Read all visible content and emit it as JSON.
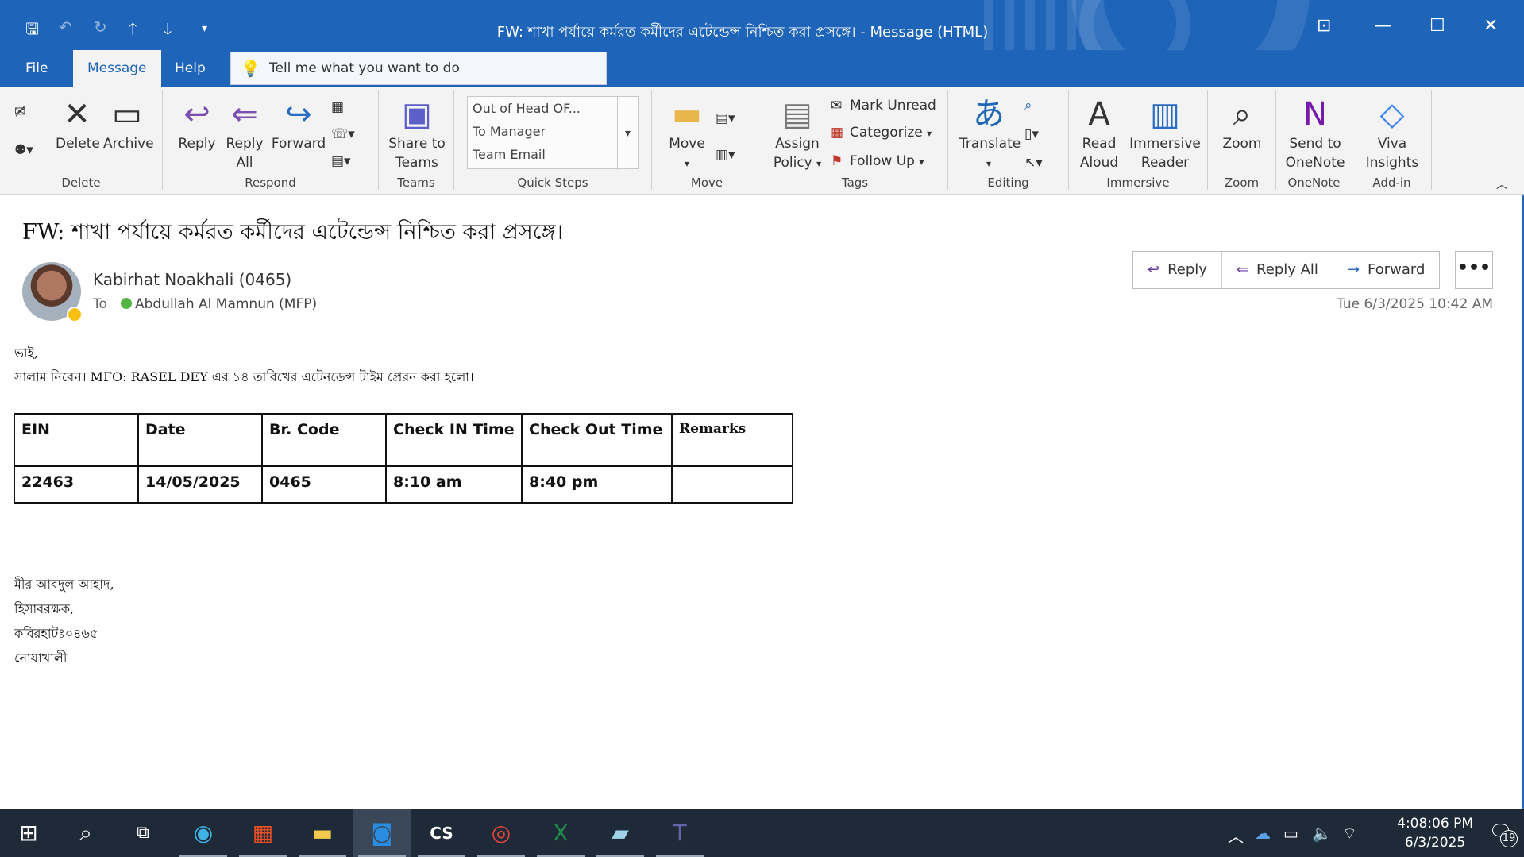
{
  "window": {
    "title": "FW: শাখা পর্যায়ে কর্মরত কর্মীদের এটেন্ডেন্স নিশ্চিত করা প্রসঙ্গে।  -  Message (HTML)"
  },
  "tabs": [
    {
      "label": "File"
    },
    {
      "label": "Message"
    },
    {
      "label": "Help"
    }
  ],
  "tellme": {
    "placeholder": "Tell me what you want to do"
  },
  "ribbon": {
    "delete_group": {
      "label": "Delete",
      "delete": "Delete",
      "archive": "Archive"
    },
    "respond_group": {
      "label": "Respond",
      "reply": "Reply",
      "reply_all_1": "Reply",
      "reply_all_2": "All",
      "forward": "Forward"
    },
    "teams_group": {
      "label": "Teams",
      "share_1": "Share to",
      "share_2": "Teams"
    },
    "quicksteps_group": {
      "label": "Quick Steps",
      "items": [
        "Out of Head OF...",
        "To Manager",
        "Team Email"
      ]
    },
    "move_group": {
      "label": "Move",
      "move": "Move"
    },
    "tags_group": {
      "label": "Tags",
      "assign_1": "Assign",
      "assign_2": "Policy",
      "mark_unread": "Mark Unread",
      "categorize": "Categorize",
      "follow_up": "Follow Up"
    },
    "editing_group": {
      "label": "Editing",
      "translate": "Translate"
    },
    "immersive_group": {
      "label": "Immersive",
      "read_1": "Read",
      "read_2": "Aloud",
      "reader_1": "Immersive",
      "reader_2": "Reader"
    },
    "zoom_group": {
      "label": "Zoom",
      "zoom": "Zoom"
    },
    "onenote_group": {
      "label": "OneNote",
      "send_1": "Send to",
      "send_2": "OneNote"
    },
    "addin_group": {
      "label": "Add-in",
      "viva_1": "Viva",
      "viva_2": "Insights"
    }
  },
  "message": {
    "subject": "FW: শাখা পর্যায়ে কর্মরত কর্মীদের এটেন্ডেন্স নিশ্চিত করা প্রসঙ্গে।",
    "sender": "Kabirhat Noakhali (0465)",
    "to_label": "To",
    "to": "Abdullah Al Mamnun (MFP)",
    "timestamp": "Tue 6/3/2025 10:42 AM",
    "actions": {
      "reply": "Reply",
      "reply_all": "Reply All",
      "forward": "Forward",
      "more": "•••"
    },
    "greeting": "ভাই,",
    "line1": "সালাম নিবেন। MFO: RASEL DEY এর ১৪ তারিখের এটেনডেন্স টাইম প্রেরন করা হলো।",
    "table": {
      "headers": [
        "EIN",
        "Date",
        "Br. Code",
        "Check IN Time",
        "Check Out Time",
        "Remarks"
      ],
      "row": [
        "22463",
        "14/05/2025",
        "0465",
        "8:10 am",
        "8:40 pm",
        ""
      ]
    },
    "signature": [
      "মীর আবদুল আহাদ,",
      "হিসাবরক্ষক,",
      "কবিরহাটঃ০৪৬৫",
      "নোয়াখালী"
    ]
  },
  "taskbar": {
    "time": "4:08:06 PM",
    "date": "6/3/2025",
    "notifications": "19"
  },
  "colors": {
    "accent": "#1e64b9",
    "taskbar": "#1f2a38"
  }
}
